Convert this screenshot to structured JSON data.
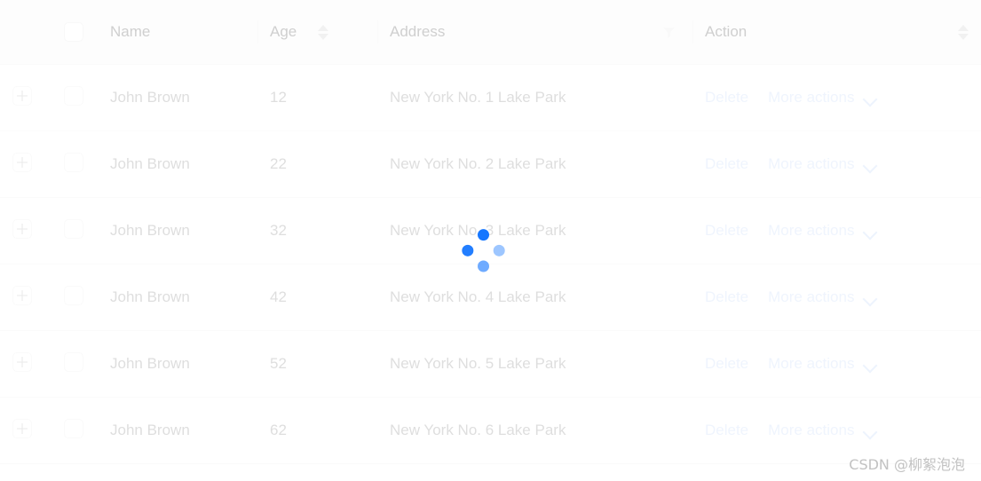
{
  "table": {
    "columns": [
      {
        "key": "expand",
        "label": "",
        "icon": "expand-plus-icon",
        "sorter": false,
        "filter": false
      },
      {
        "key": "select",
        "label": "",
        "icon": "select-all-checkbox",
        "sorter": false,
        "filter": false
      },
      {
        "key": "name",
        "label": "Name",
        "sorter": false,
        "filter": false
      },
      {
        "key": "age",
        "label": "Age",
        "sorter": true,
        "filter": false
      },
      {
        "key": "address",
        "label": "Address",
        "sorter": false,
        "filter": true
      },
      {
        "key": "action",
        "label": "Action",
        "sorter": true,
        "filter": false
      }
    ],
    "rows": [
      {
        "name": "John Brown",
        "age": "12",
        "address": "New York No. 1 Lake Park",
        "delete_label": "Delete",
        "more_label": "More actions"
      },
      {
        "name": "John Brown",
        "age": "22",
        "address": "New York No. 2 Lake Park",
        "delete_label": "Delete",
        "more_label": "More actions"
      },
      {
        "name": "John Brown",
        "age": "32",
        "address": "New York No. 3 Lake Park",
        "delete_label": "Delete",
        "more_label": "More actions"
      },
      {
        "name": "John Brown",
        "age": "42",
        "address": "New York No. 4 Lake Park",
        "delete_label": "Delete",
        "more_label": "More actions"
      },
      {
        "name": "John Brown",
        "age": "52",
        "address": "New York No. 5 Lake Park",
        "delete_label": "Delete",
        "more_label": "More actions"
      },
      {
        "name": "John Brown",
        "age": "62",
        "address": "New York No. 6 Lake Park",
        "delete_label": "Delete",
        "more_label": "More actions"
      }
    ]
  },
  "loading": {
    "active": true,
    "spinner_icon": "dot-spinner-icon",
    "spinner_color": "#1677ff"
  },
  "watermark": {
    "text": "CSDN @柳絮泡泡"
  },
  "colors": {
    "header_bg": "#fafafa",
    "row_bg": "#ffffff",
    "border": "#f0f0f0",
    "text": "#9a9a9a",
    "link": "#cfe0fa",
    "accent": "#1677ff"
  }
}
